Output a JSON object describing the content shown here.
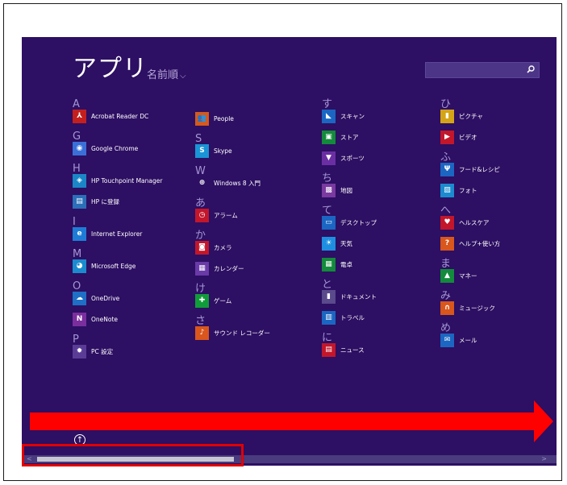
{
  "header": {
    "title": "アプリ",
    "sort_label": "名前順",
    "sort_icon": "chevron-down-icon",
    "search_icon": "search-icon"
  },
  "columns": {
    "c1": [
      {
        "type": "letter",
        "text": "A"
      },
      {
        "type": "app",
        "name": "Acrobat Reader DC",
        "color": "#c41f1f",
        "glyph": "⅄",
        "icon": "acrobat-icon"
      },
      {
        "type": "letter",
        "text": "G"
      },
      {
        "type": "app",
        "name": "Google Chrome",
        "color": "#3a6fd8",
        "glyph": "◉",
        "icon": "chrome-icon"
      },
      {
        "type": "letter",
        "text": "H"
      },
      {
        "type": "app",
        "name": "HP Touchpoint Manager",
        "color": "#1a86c8",
        "glyph": "◈",
        "icon": "hp-touchpoint-icon"
      },
      {
        "type": "app",
        "name": "HP に登録",
        "color": "#2b6fb8",
        "glyph": "▤",
        "icon": "hp-register-icon"
      },
      {
        "type": "letter",
        "text": "I"
      },
      {
        "type": "app",
        "name": "Internet Explorer",
        "color": "#1e7cd6",
        "glyph": "e",
        "icon": "ie-icon"
      },
      {
        "type": "letter",
        "text": "M"
      },
      {
        "type": "app",
        "name": "Microsoft Edge",
        "color": "#1b8bcf",
        "glyph": "◕",
        "icon": "edge-icon"
      },
      {
        "type": "letter",
        "text": "O"
      },
      {
        "type": "app",
        "name": "OneDrive",
        "color": "#1e6fc5",
        "glyph": "☁",
        "icon": "onedrive-icon"
      },
      {
        "type": "app",
        "name": "OneNote",
        "color": "#7b2e9e",
        "glyph": "N",
        "icon": "onenote-icon"
      },
      {
        "type": "letter",
        "text": "P"
      },
      {
        "type": "app",
        "name": "PC 設定",
        "color": "#5a3c96",
        "glyph": "✹",
        "icon": "settings-gear-icon"
      }
    ],
    "c2": [
      {
        "type": "app",
        "name": "People",
        "color": "#d45a1d",
        "glyph": "👥",
        "icon": "people-icon"
      },
      {
        "type": "letter",
        "text": "S"
      },
      {
        "type": "app",
        "name": "Skype",
        "color": "#1994d6",
        "glyph": "S",
        "icon": "skype-icon"
      },
      {
        "type": "letter",
        "text": "W"
      },
      {
        "type": "app",
        "name": "Windows 8 入門",
        "color": "#2d0f63",
        "glyph": "⊕",
        "icon": "windows-help-icon"
      },
      {
        "type": "letter",
        "text": "あ"
      },
      {
        "type": "app",
        "name": "アラーム",
        "color": "#c3162b",
        "glyph": "◷",
        "icon": "alarm-icon"
      },
      {
        "type": "letter",
        "text": "か"
      },
      {
        "type": "app",
        "name": "カメラ",
        "color": "#c3162b",
        "glyph": "◙",
        "icon": "camera-icon"
      },
      {
        "type": "app",
        "name": "カレンダー",
        "color": "#6a3aa8",
        "glyph": "▦",
        "icon": "calendar-icon"
      },
      {
        "type": "letter",
        "text": "け"
      },
      {
        "type": "app",
        "name": "ゲーム",
        "color": "#119c3a",
        "glyph": "✚",
        "icon": "game-icon"
      },
      {
        "type": "letter",
        "text": "さ"
      },
      {
        "type": "app",
        "name": "サウンド レコーダー",
        "color": "#d9561c",
        "glyph": "♪",
        "icon": "sound-recorder-icon"
      }
    ],
    "c3": [
      {
        "type": "letter",
        "text": "す"
      },
      {
        "type": "app",
        "name": "スキャン",
        "color": "#1b66c2",
        "glyph": "◣",
        "icon": "scan-icon"
      },
      {
        "type": "app",
        "name": "ストア",
        "color": "#138a3c",
        "glyph": "▣",
        "icon": "store-icon"
      },
      {
        "type": "app",
        "name": "スポーツ",
        "color": "#6b2fa3",
        "glyph": "▼",
        "icon": "sports-icon"
      },
      {
        "type": "letter",
        "text": "ち"
      },
      {
        "type": "app",
        "name": "地図",
        "color": "#7a3aa0",
        "glyph": "▩",
        "icon": "map-icon"
      },
      {
        "type": "letter",
        "text": "て"
      },
      {
        "type": "app",
        "name": "デスクトップ",
        "color": "#1b66c2",
        "glyph": "▭",
        "icon": "desktop-icon"
      },
      {
        "type": "app",
        "name": "天気",
        "color": "#1e8fe0",
        "glyph": "☀",
        "icon": "weather-icon"
      },
      {
        "type": "app",
        "name": "電卓",
        "color": "#138a3c",
        "glyph": "▦",
        "icon": "calculator-icon"
      },
      {
        "type": "letter",
        "text": "と"
      },
      {
        "type": "app",
        "name": "ドキュメント",
        "color": "#5b4a8c",
        "glyph": "▮",
        "icon": "documents-icon"
      },
      {
        "type": "app",
        "name": "トラベル",
        "color": "#1b66c2",
        "glyph": "▥",
        "icon": "travel-icon"
      },
      {
        "type": "letter",
        "text": "に"
      },
      {
        "type": "app",
        "name": "ニュース",
        "color": "#c3162b",
        "glyph": "▤",
        "icon": "news-icon"
      }
    ],
    "c4": [
      {
        "type": "letter",
        "text": "ひ"
      },
      {
        "type": "app",
        "name": "ピクチャ",
        "color": "#d5a416",
        "glyph": "▮",
        "icon": "pictures-icon"
      },
      {
        "type": "app",
        "name": "ビデオ",
        "color": "#c3162b",
        "glyph": "▶",
        "icon": "video-icon"
      },
      {
        "type": "letter",
        "text": "ふ"
      },
      {
        "type": "app",
        "name": "フード&レシピ",
        "color": "#1b66c2",
        "glyph": "Ψ",
        "icon": "food-icon"
      },
      {
        "type": "app",
        "name": "フォト",
        "color": "#1b8bcf",
        "glyph": "▨",
        "icon": "photos-icon"
      },
      {
        "type": "letter",
        "text": "へ"
      },
      {
        "type": "app",
        "name": "ヘルスケア",
        "color": "#c3162b",
        "glyph": "♥",
        "icon": "health-icon"
      },
      {
        "type": "app",
        "name": "ヘルプ+使い方",
        "color": "#d9561c",
        "glyph": "?",
        "icon": "help-icon"
      },
      {
        "type": "letter",
        "text": "ま"
      },
      {
        "type": "app",
        "name": "マネー",
        "color": "#138a3c",
        "glyph": "▲",
        "icon": "money-icon"
      },
      {
        "type": "letter",
        "text": "み"
      },
      {
        "type": "app",
        "name": "ミュージック",
        "color": "#d9561c",
        "glyph": "∩",
        "icon": "music-icon"
      },
      {
        "type": "letter",
        "text": "め"
      },
      {
        "type": "app",
        "name": "メール",
        "color": "#1b66c2",
        "glyph": "✉",
        "icon": "mail-icon"
      }
    ]
  },
  "controls": {
    "up_glyph": "↑",
    "scroll_left": "<",
    "scroll_right": ">"
  },
  "colors": {
    "background": "#2d0f63",
    "highlight": "#ff0000"
  }
}
